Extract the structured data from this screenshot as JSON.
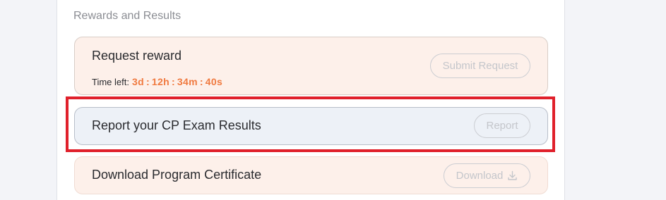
{
  "section": {
    "title": "Rewards and Results"
  },
  "request_card": {
    "title": "Request reward",
    "time_left_label": "Time left:",
    "timer": {
      "days": "3d",
      "hours": "12h",
      "minutes": "34m",
      "seconds": "40s",
      "separator": ":"
    },
    "button_label": "Submit Request"
  },
  "report_card": {
    "title": "Report your CP Exam Results",
    "button_label": "Report"
  },
  "download_card": {
    "title": "Download Program Certificate",
    "button_label": "Download",
    "button_icon": "download-icon"
  },
  "colors": {
    "accent_orange": "#f07a40",
    "highlight_red": "#e0202b",
    "card_peach": "#fdf0ea",
    "card_blue": "#edf1f7"
  }
}
